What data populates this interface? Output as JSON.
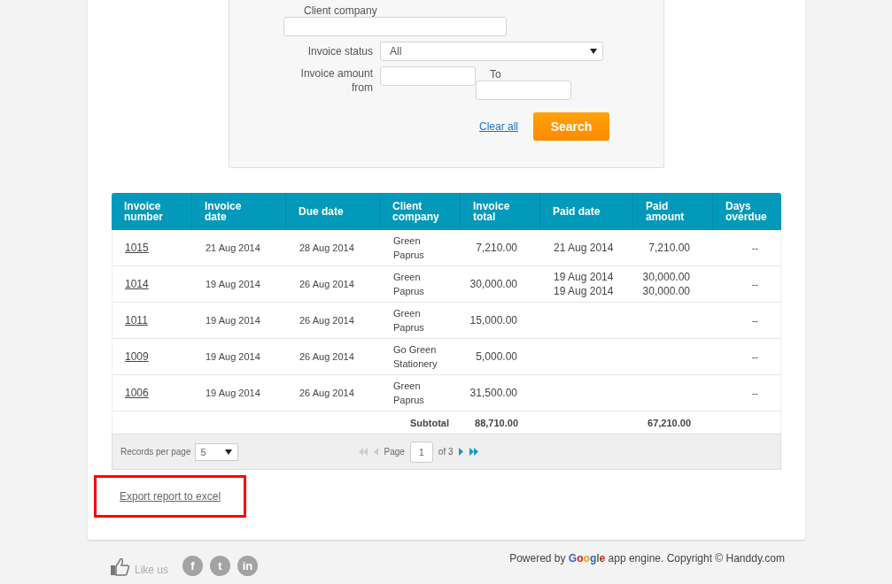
{
  "filters": {
    "client_company": {
      "label": "Client company"
    },
    "invoice_status": {
      "label": "Invoice status",
      "value": "All"
    },
    "amount": {
      "label": "Invoice amount from",
      "to_label": "To"
    },
    "clear_all": "Clear all",
    "search": "Search"
  },
  "table": {
    "columns": [
      "Invoice number",
      "Invoice date",
      "Due date",
      "Client company",
      "Invoice total",
      "Paid date",
      "Paid amount",
      "Days overdue"
    ],
    "rows": [
      {
        "number": "1015",
        "invoice_date": "21 Aug 2014",
        "due_date": "28 Aug 2014",
        "client": "Green Paprus",
        "total": "7,210.00",
        "paid_dates": [
          "21 Aug 2014"
        ],
        "paid_amounts": [
          "7,210.00"
        ],
        "overdue": "--"
      },
      {
        "number": "1014",
        "invoice_date": "19 Aug 2014",
        "due_date": "26 Aug 2014",
        "client": "Green Paprus",
        "total": "30,000.00",
        "paid_dates": [
          "19 Aug 2014",
          "19 Aug 2014"
        ],
        "paid_amounts": [
          "30,000.00",
          "30,000.00"
        ],
        "overdue": "--"
      },
      {
        "number": "1011",
        "invoice_date": "19 Aug 2014",
        "due_date": "26 Aug 2014",
        "client": "Green Paprus",
        "total": "15,000.00",
        "paid_dates": [],
        "paid_amounts": [],
        "overdue": "--"
      },
      {
        "number": "1009",
        "invoice_date": "19 Aug 2014",
        "due_date": "26 Aug 2014",
        "client": "Go Green Stationery",
        "total": "5,000.00",
        "paid_dates": [],
        "paid_amounts": [],
        "overdue": "--"
      },
      {
        "number": "1006",
        "invoice_date": "19 Aug 2014",
        "due_date": "26 Aug 2014",
        "client": "Green Paprus",
        "total": "31,500.00",
        "paid_dates": [],
        "paid_amounts": [],
        "overdue": "--"
      }
    ],
    "subtotal": {
      "label": "Subtotal",
      "total": "88,710.00",
      "paid": "67,210.00"
    }
  },
  "pager": {
    "records_label": "Records per page",
    "per_page": "5",
    "page_label": "Page",
    "page": "1",
    "of": "of 3",
    "nav": [
      {
        "kind": "first",
        "disabled": true
      },
      {
        "kind": "prev",
        "disabled": true
      },
      {
        "kind": "next",
        "disabled": false
      },
      {
        "kind": "last",
        "disabled": false
      }
    ]
  },
  "export": {
    "label": "Export report to excel",
    "highlighted": true
  },
  "footer": {
    "like": "Like us",
    "social": [
      "f",
      "t",
      "in"
    ],
    "powered_prefix": "Powered by",
    "brand": "Google",
    "powered_suffix": "app engine. Copyright © Handdy.com"
  }
}
